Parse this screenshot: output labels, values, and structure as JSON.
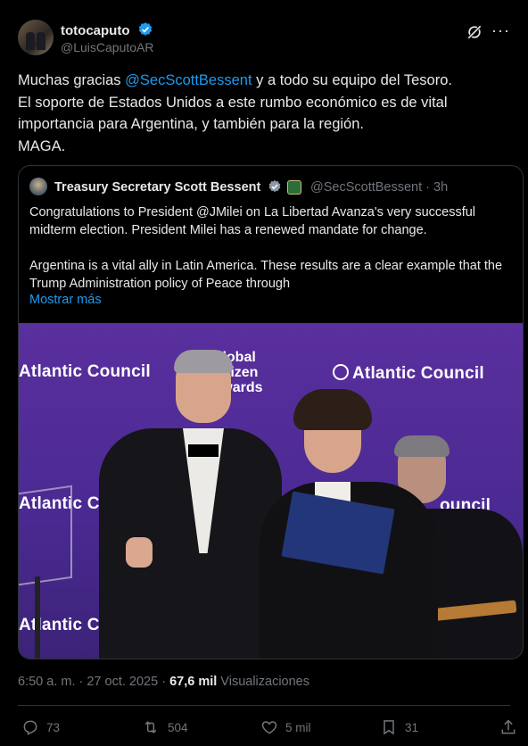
{
  "author": {
    "display_name": "totocaputo",
    "handle": "@LuisCaputoAR"
  },
  "tweet": {
    "text_before": "Muchas gracias ",
    "mention": "@SecScottBessent",
    "text_line1_after": " y a todo su equipo del Tesoro.",
    "line2": "El soporte de Estados Unidos a este rumbo económico es de vital",
    "line3": "importancia para Argentina, y también para la región.",
    "line4": "MAGA."
  },
  "quote": {
    "display_name": "Treasury Secretary Scott Bessent",
    "meta": "@SecScottBessent · 3h",
    "para1": "Congratulations to President @JMilei on La Libertad Avanza's very successful midterm election. President Milei has a renewed mandate for change.",
    "para2": "Argentina is a vital ally in Latin America. These results are a clear example that the Trump Administration policy of Peace through",
    "show_more": "Mostrar más",
    "image": {
      "sign_left_top": "Atlantic Council",
      "sign_right_top": "Atlantic Council",
      "sign_left_mid": "Atlantic Cou",
      "sign_right_mid": "ouncil",
      "sign_left_bottom": "Atlantic Counc",
      "gca_line1": "Global",
      "gca_line2": "Citizen",
      "gca_line3": "Awards"
    }
  },
  "timestamp": {
    "date": "6:50 a. m. · 27 oct. 2025 · ",
    "views_count": "67,6 mil",
    "views_label": " Visualizaciones"
  },
  "actions": {
    "replies": "73",
    "reposts": "504",
    "likes": "5 mil",
    "bookmarks": "31"
  },
  "colors": {
    "background": "#000000",
    "text": "#e7e9ea",
    "muted": "#71767b",
    "link": "#1d9bf0",
    "border": "#2f3336"
  }
}
